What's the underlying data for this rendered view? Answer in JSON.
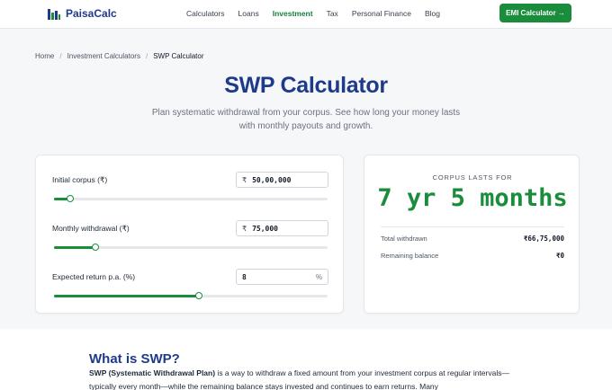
{
  "header": {
    "logo": "PaisaCalc",
    "nav": [
      "Calculators",
      "Loans",
      "Investment",
      "Tax",
      "Personal Finance",
      "Blog"
    ],
    "active_nav": "Investment",
    "cta": "EMI Calculator →"
  },
  "breadcrumb": [
    "Home",
    "Investment Calculators",
    "SWP Calculator"
  ],
  "page": {
    "title": "SWP Calculator",
    "subtitle": "Plan systematic withdrawal from your corpus. See how long your money lasts with monthly payouts and growth."
  },
  "calculator": {
    "fields": [
      {
        "label": "Initial corpus (₹)",
        "prefix": "₹",
        "value": "50,00,000",
        "slider_fraction": 0.06
      },
      {
        "label": "Monthly withdrawal (₹)",
        "prefix": "₹",
        "value": "75,000",
        "slider_fraction": 0.15
      },
      {
        "label": "Expected return p.a. (%)",
        "value": "8",
        "suffix": "%",
        "slider_fraction": 0.53
      }
    ]
  },
  "result": {
    "label": "CORPUS LASTS FOR",
    "value": "7 yr 5 months",
    "rows": [
      {
        "label": "Total withdrawn",
        "value": "₹66,75,000"
      },
      {
        "label": "Remaining balance",
        "value": "₹0"
      }
    ]
  },
  "info": {
    "heading": "What is SWP?",
    "term": "SWP (Systematic Withdrawal Plan)",
    "text": " is a way to withdraw a fixed amount from your investment corpus at regular intervals—typically every month—while the remaining balance stays invested and continues to earn returns. Many"
  },
  "colors": {
    "brand_green": "#1a8d3c",
    "brand_navy": "#1e3a8a"
  }
}
